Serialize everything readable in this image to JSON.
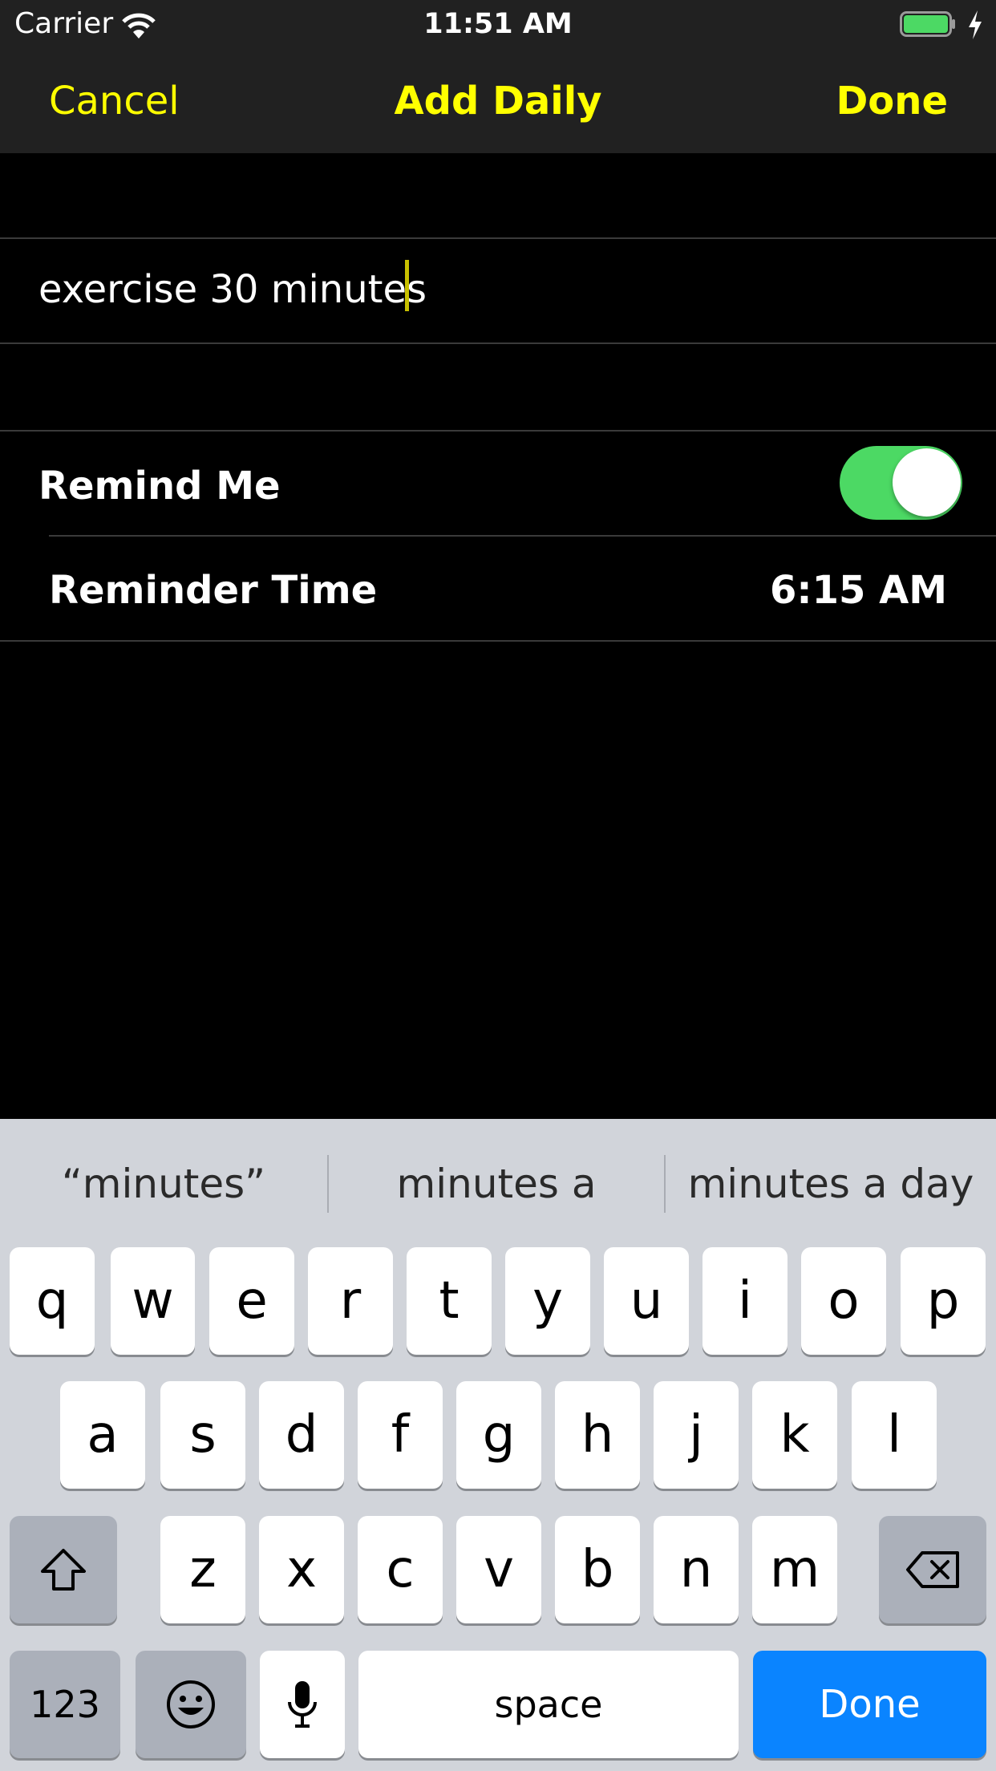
{
  "status_bar": {
    "carrier": "Carrier",
    "time": "11:51 AM",
    "battery_color": "#4cd964"
  },
  "nav": {
    "cancel_label": "Cancel",
    "title": "Add Daily",
    "done_label": "Done",
    "accent": "#ffff00"
  },
  "form": {
    "task_name_value": "exercise 30 minutes",
    "remind_me_label": "Remind Me",
    "remind_me_on": true,
    "reminder_time_label": "Reminder Time",
    "reminder_time_value": "6:15 AM"
  },
  "keyboard": {
    "suggestions": [
      "“minutes”",
      "minutes a",
      "minutes a day"
    ],
    "row1": [
      "q",
      "w",
      "e",
      "r",
      "t",
      "y",
      "u",
      "i",
      "o",
      "p"
    ],
    "row2": [
      "a",
      "s",
      "d",
      "f",
      "g",
      "h",
      "j",
      "k",
      "l"
    ],
    "row3": [
      "z",
      "x",
      "c",
      "v",
      "b",
      "n",
      "m"
    ],
    "numbers_label": "123",
    "space_label": "space",
    "return_label": "Done",
    "icons": {
      "shift": "shift-icon",
      "delete": "delete-icon",
      "emoji": "emoji-icon",
      "mic": "microphone-icon"
    }
  }
}
